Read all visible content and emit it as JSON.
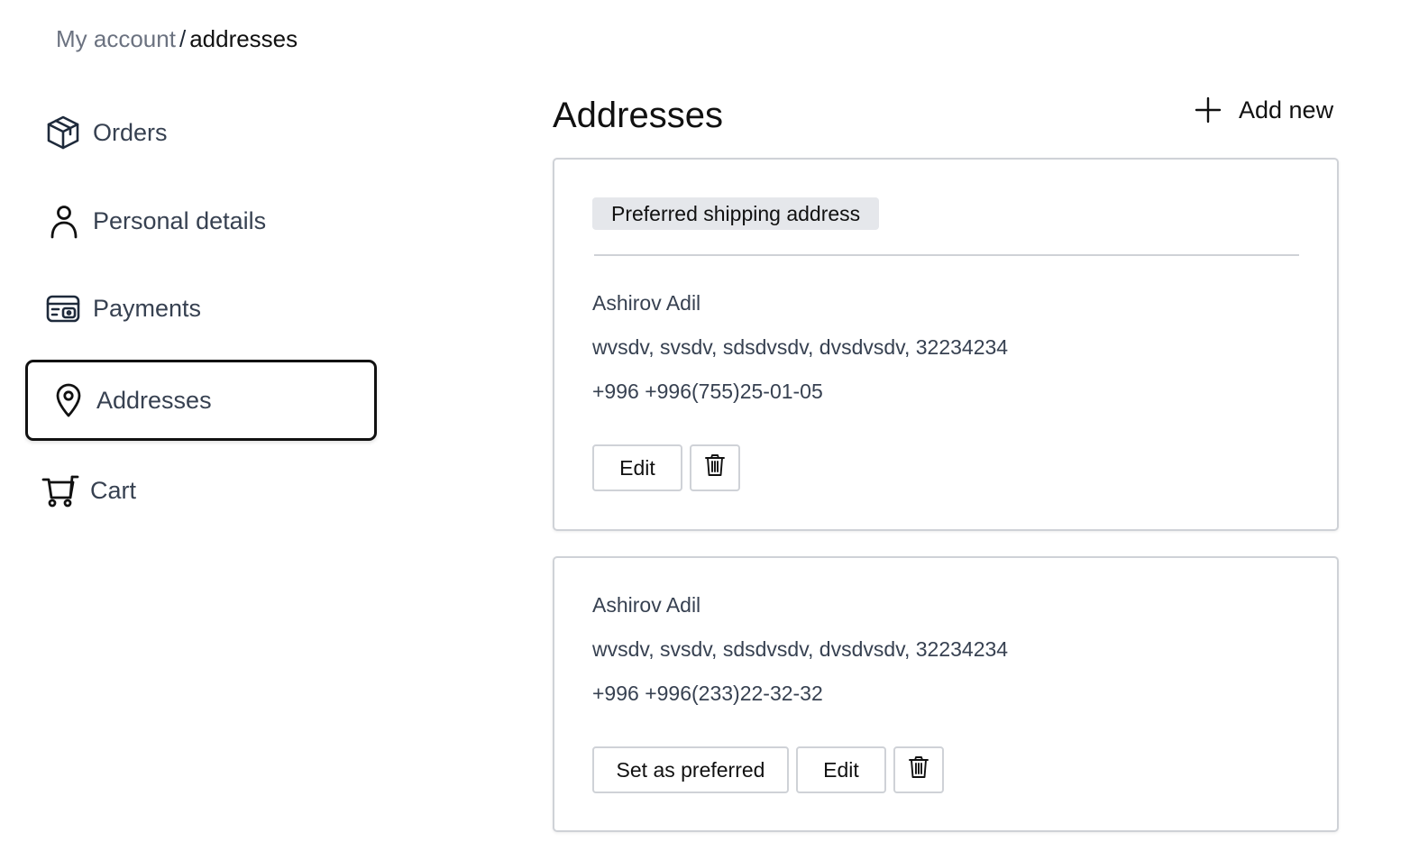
{
  "breadcrumb": {
    "parent": "My account",
    "separator": "/",
    "current": "addresses"
  },
  "sidebar": {
    "items": [
      {
        "label": "Orders",
        "icon": "box-icon",
        "active": false
      },
      {
        "label": "Personal details",
        "icon": "user-icon",
        "active": false
      },
      {
        "label": "Payments",
        "icon": "payment-card-icon",
        "active": false
      },
      {
        "label": "Addresses",
        "icon": "map-pin-icon",
        "active": true
      },
      {
        "label": "Cart",
        "icon": "cart-icon",
        "active": false
      }
    ]
  },
  "main": {
    "title": "Addresses",
    "add_new_label": "Add new",
    "add_new_icon": "plus-icon",
    "addresses": [
      {
        "badge": "Preferred shipping address",
        "name": "Ashirov Adil",
        "address": "wvsdv, svsdv, sdsdvsdv, dvsdvsdv, 32234234",
        "phone": "+996 +996(755)25-01-05",
        "edit_label": "Edit",
        "delete_icon": "trash-icon"
      },
      {
        "name": "Ashirov Adil",
        "address": "wvsdv, svsdv, sdsdvsdv, dvsdvsdv, 32234234",
        "phone": "+996 +996(233)22-32-32",
        "set_preferred_label": "Set as preferred",
        "edit_label": "Edit",
        "delete_icon": "trash-icon"
      }
    ]
  },
  "colors": {
    "text_primary": "#111111",
    "text_secondary": "#374151",
    "text_muted": "#6b7280",
    "border": "#cfd2d7",
    "badge_bg": "#e5e7eb",
    "icon_stroke": "#1e2a3b"
  }
}
